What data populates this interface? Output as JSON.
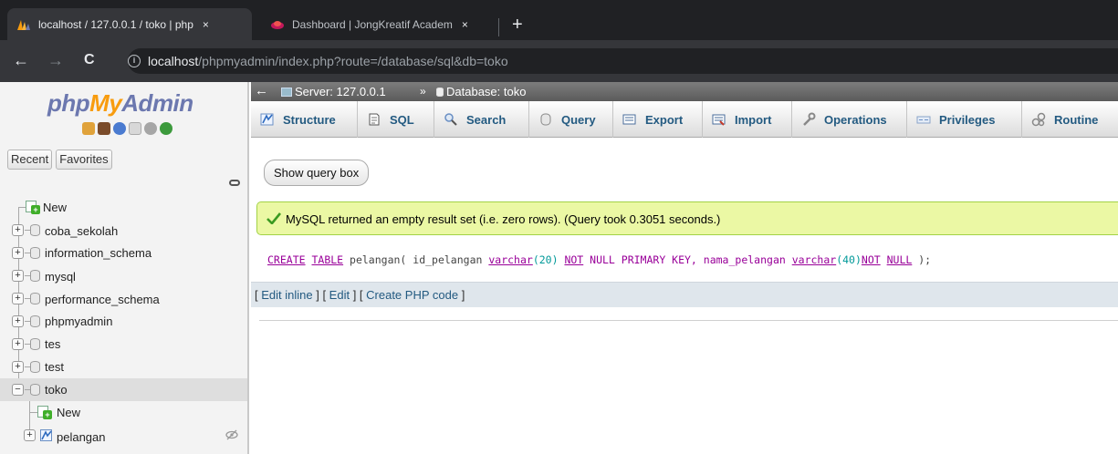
{
  "browser": {
    "tabs": [
      {
        "title": "localhost / 127.0.0.1 / toko | php",
        "active": true,
        "close": "×"
      },
      {
        "title": "Dashboard | JongKreatif Academ",
        "active": false,
        "close": "×"
      }
    ],
    "new_tab": "+",
    "nav": {
      "back": "←",
      "forward": "→",
      "reload": "C"
    },
    "url": {
      "info": "i",
      "host": "localhost",
      "path": "/phpmyadmin/index.php?route=/database/sql&db=toko"
    }
  },
  "sidebar": {
    "logo_php": "php",
    "logo_my": "My",
    "logo_admin": "Admin",
    "recent_label": "Recent",
    "favorites_label": "Favorites",
    "tree": [
      {
        "label": "New",
        "kind": "new"
      },
      {
        "label": "coba_sekolah",
        "kind": "db",
        "expander": "+"
      },
      {
        "label": "information_schema",
        "kind": "db",
        "expander": "+"
      },
      {
        "label": "mysql",
        "kind": "db",
        "expander": "+"
      },
      {
        "label": "performance_schema",
        "kind": "db",
        "expander": "+"
      },
      {
        "label": "phpmyadmin",
        "kind": "db",
        "expander": "+"
      },
      {
        "label": "tes",
        "kind": "db",
        "expander": "+"
      },
      {
        "label": "test",
        "kind": "db",
        "expander": "+"
      },
      {
        "label": "toko",
        "kind": "db",
        "expander": "−",
        "selected": true
      },
      {
        "label": "New",
        "kind": "new-child"
      },
      {
        "label": "pelangan",
        "kind": "table",
        "expander": "+"
      }
    ]
  },
  "breadcrumb": {
    "server": "Server: 127.0.0.1",
    "separator": "»",
    "database": "Database: toko"
  },
  "menu": {
    "tabs": [
      {
        "label": "Structure",
        "icon": "structure-icon"
      },
      {
        "label": "SQL",
        "icon": "sql-icon"
      },
      {
        "label": "Search",
        "icon": "search-icon"
      },
      {
        "label": "Query",
        "icon": "query-icon"
      },
      {
        "label": "Export",
        "icon": "export-icon"
      },
      {
        "label": "Import",
        "icon": "import-icon"
      },
      {
        "label": "Operations",
        "icon": "wrench-icon"
      },
      {
        "label": "Privileges",
        "icon": "privileges-icon"
      },
      {
        "label": "Routine",
        "icon": "routines-icon"
      }
    ]
  },
  "content": {
    "show_query_box": "Show query box",
    "success_message": "MySQL returned an empty result set (i.e. zero rows). (Query took 0.3051 seconds.)",
    "sql": {
      "create": "CREATE",
      "table": "TABLE",
      "t1": " pelangan( id_pelangan ",
      "varchar1": "varchar",
      "n20": "(20) ",
      "not1": "NOT",
      "t2": " NULL PRIMARY KEY, nama_pelangan ",
      "varchar2": "varchar",
      "n40": "(40)",
      "not2": "NOT",
      "t3": " ",
      "null2": "NULL",
      "t4": " );"
    },
    "tools": {
      "open1": "[ ",
      "edit_inline": "Edit inline",
      "mid1": " ] [ ",
      "edit": "Edit",
      "mid2": " ] [ ",
      "create_php": "Create PHP code",
      "close": " ]"
    }
  },
  "colors": {
    "accent_link": "#235a81",
    "success_bg": "#ebf8a4",
    "logo_blue": "#6c78af",
    "logo_orange": "#f89c0e"
  }
}
